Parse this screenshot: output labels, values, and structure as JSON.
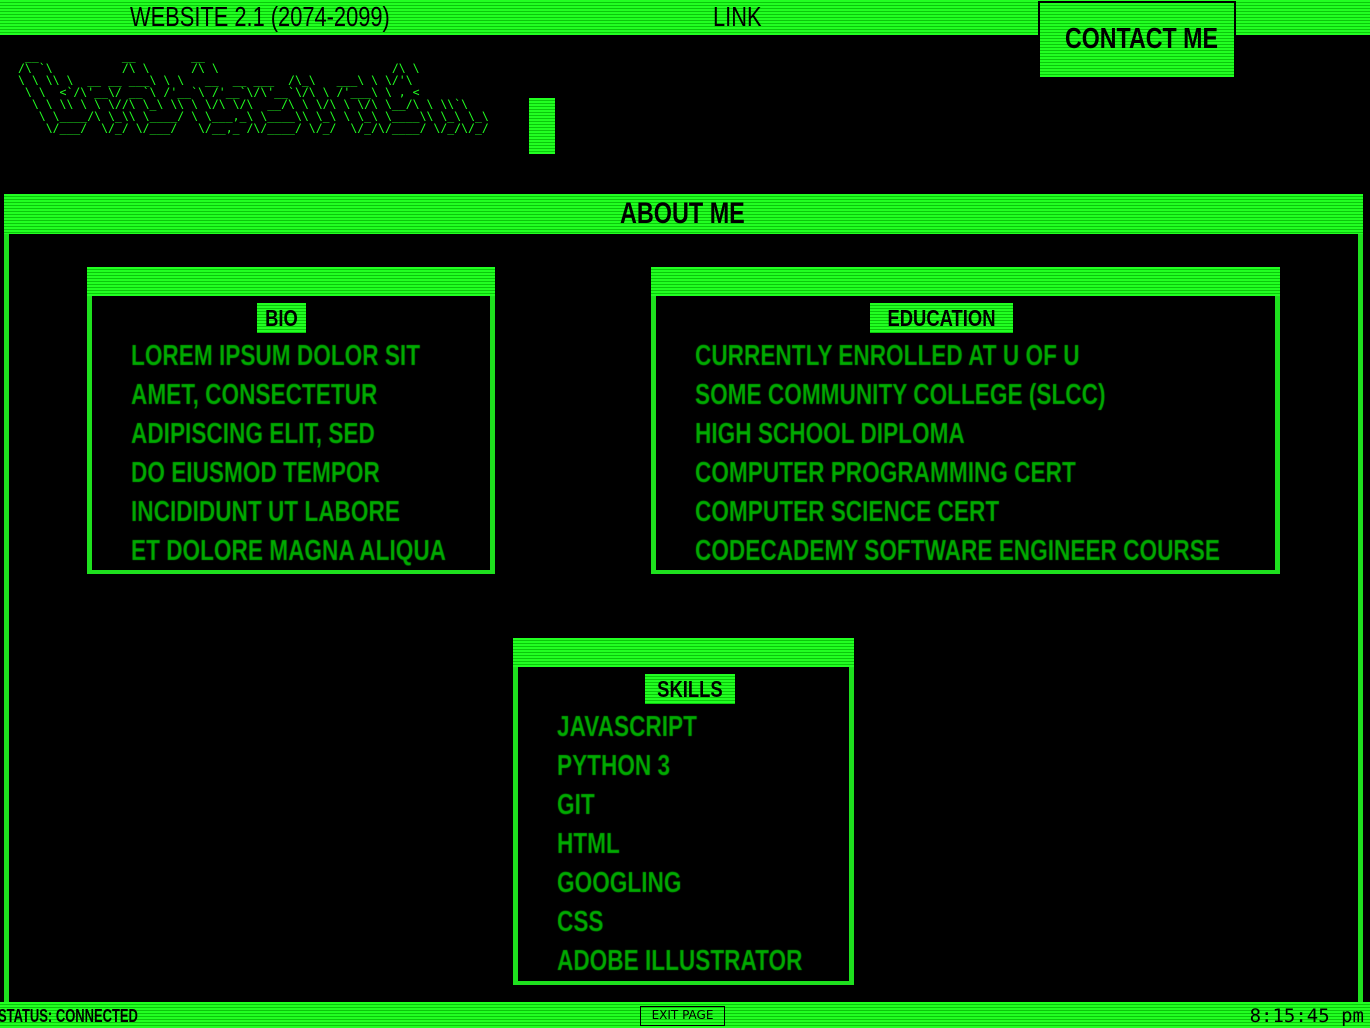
{
  "topbar": {
    "site_title": "WEBSITE 2.1 (2074-2099)",
    "link_label": "LINK",
    "contact_label": "CONTACT ME"
  },
  "logo": {
    "ascii": " __            __        __\n/\\ `\\          /\\ \\      /\\ \\                         /\\ \\\n\\ \\ \\\\ \\  __ __ ___\\ \\ \\   __  __ ___  /\\_\\   ___\\ \\ \\/'\\\n \\ \\  <`/\\'__\\/ __`\\ /'__`\\ /'__`\\/\\'__`\\/\\ \\ /'___\\ \\ , <\n  \\ \\ \\\\ \\ \\ \\//\\ \\_\\ \\\\ \\ \\/\\ \\/\\  __/\\ \\ \\/\\ \\ \\/\\ \\__/\\ \\ \\\\`\\\n   \\ \\____/\\ \\_\\\\ \\____/ \\ \\___,_\\ \\____\\\\ \\_\\ \\ \\_\\ \\____\\\\ \\_\\ \\_\\\n    \\/___/  \\/_/ \\/___/   \\/__,_ /\\/____/ \\/_/  \\/_/\\/____/ \\/_/\\/_/"
  },
  "about": {
    "title": "ABOUT ME",
    "bio": {
      "title": "BIO",
      "items": [
        "LOREM IPSUM DOLOR SIT",
        "AMET, CONSECTETUR",
        "ADIPISCING ELIT, SED",
        "DO EIUSMOD TEMPOR",
        "INCIDIDUNT UT LABORE",
        "ET DOLORE MAGNA ALIQUA"
      ]
    },
    "education": {
      "title": "EDUCATION",
      "items": [
        "CURRENTLY ENROLLED AT U OF U",
        "SOME COMMUNITY COLLEGE (SLCC)",
        "HIGH SCHOOL DIPLOMA",
        "COMPUTER PROGRAMMING CERT",
        "COMPUTER SCIENCE CERT",
        "CODECADEMY SOFTWARE ENGINEER COURSE"
      ]
    },
    "skills": {
      "title": "SKILLS",
      "items": [
        "JAVASCRIPT",
        "PYTHON 3",
        "GIT",
        "HTML",
        "GOOGLING",
        "CSS",
        "ADOBE ILLUSTRATOR"
      ]
    }
  },
  "statusbar": {
    "status": "STATUS: CONNECTED",
    "exit_label": "EXIT PAGE",
    "clock": "8:15:45 pm"
  },
  "colors": {
    "accent": "#22ff22",
    "background": "#000000",
    "stripe_dark": "#0bc80b"
  }
}
